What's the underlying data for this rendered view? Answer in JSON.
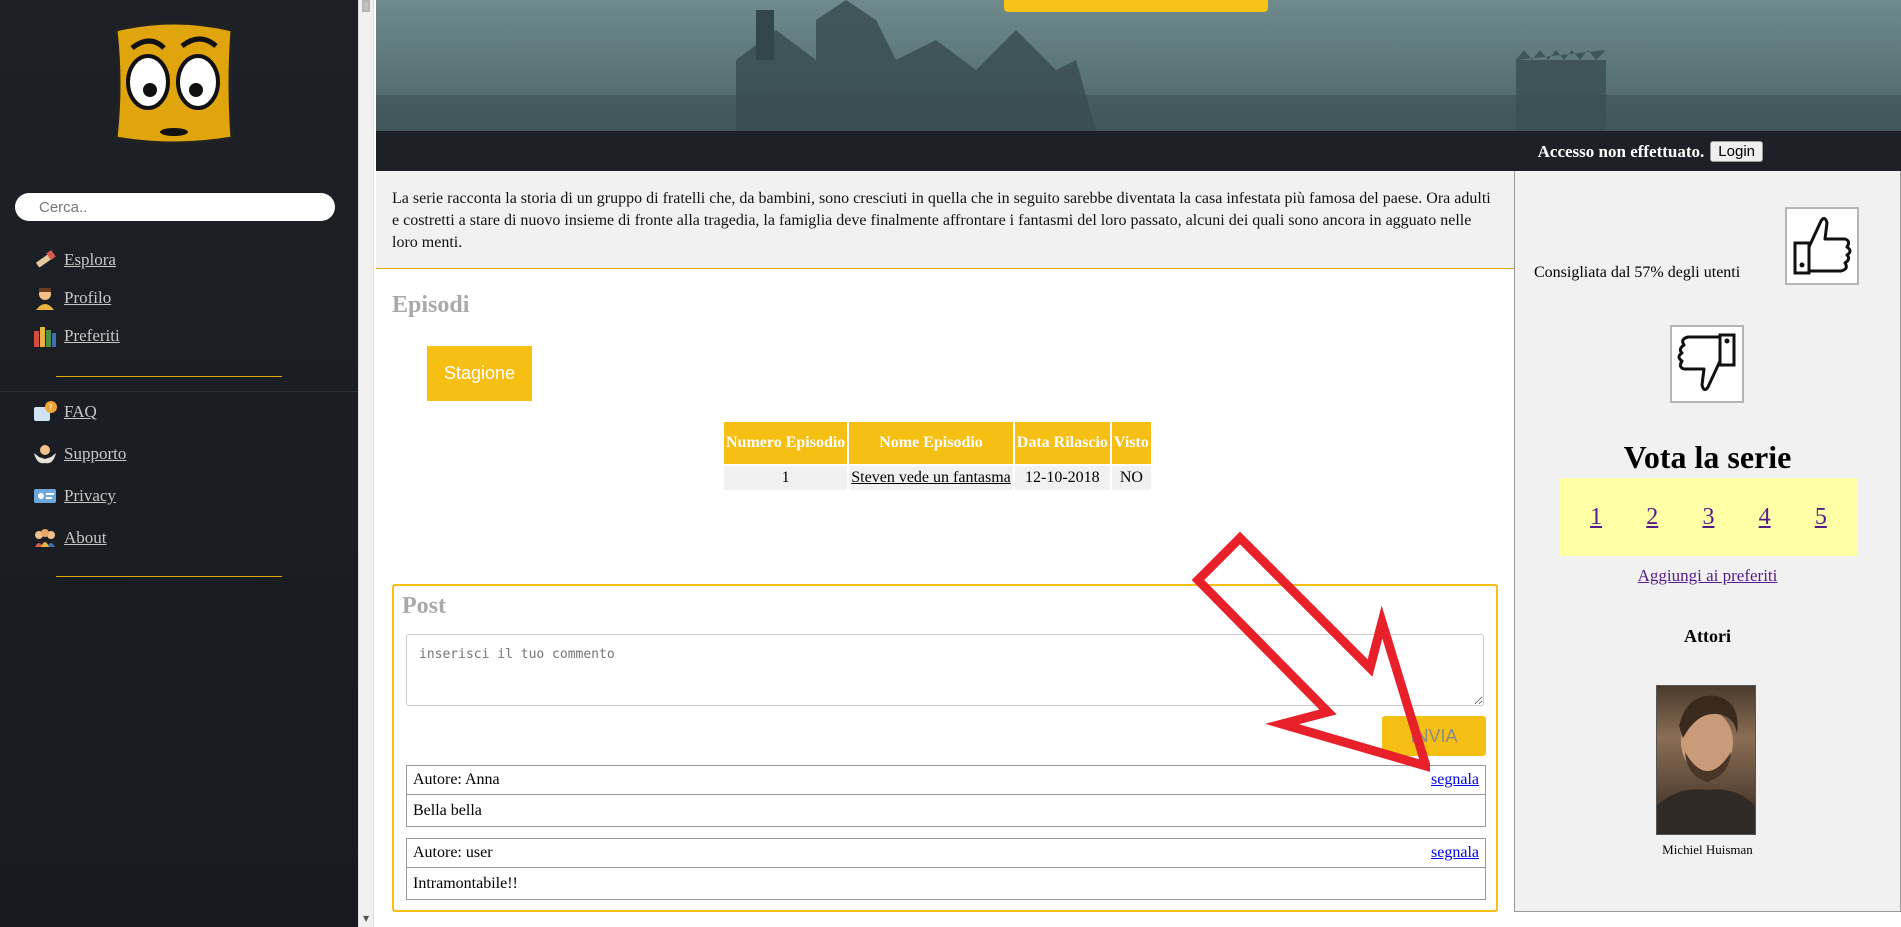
{
  "sidebar": {
    "search_placeholder": "Cerca..",
    "nav_main": [
      {
        "label": "Esplora",
        "icon": "flashlight-icon"
      },
      {
        "label": "Profilo",
        "icon": "user-icon"
      },
      {
        "label": "Preferiti",
        "icon": "books-icon"
      }
    ],
    "nav_info": [
      {
        "label": "FAQ",
        "icon": "faq-icon"
      },
      {
        "label": "Supporto",
        "icon": "support-icon"
      },
      {
        "label": "Privacy",
        "icon": "privacy-icon"
      },
      {
        "label": "About",
        "icon": "team-icon"
      }
    ]
  },
  "topbar": {
    "status": "Accesso non effettuato.",
    "login_label": "Login"
  },
  "description": "La serie racconta la storia di un gruppo di fratelli che, da bambini, sono cresciuti in quella che in seguito sarebbe diventata la casa infestata più famosa del paese. Ora adulti e costretti a stare di nuovo insieme di fronte alla tragedia, la famiglia deve finalmente affrontare i fantasmi del loro passato, alcuni dei quali sono ancora in agguato nelle loro menti.",
  "episodes": {
    "title": "Episodi",
    "season_button": "Stagione",
    "columns": [
      "Numero Episodio",
      "Nome Episodio",
      "Data Rilascio",
      "Visto"
    ],
    "rows": [
      {
        "numero": "1",
        "nome": "Steven vede un fantasma",
        "data": "12-10-2018",
        "visto": "NO"
      }
    ]
  },
  "post": {
    "title": "Post",
    "placeholder": "inserisci il tuo commento",
    "send_label": "INVIA",
    "comments": [
      {
        "author": "Autore: Anna",
        "report": "segnala",
        "text": "Bella bella"
      },
      {
        "author": "Autore: user",
        "report": "segnala",
        "text": "Intramontabile!!"
      }
    ]
  },
  "right_panel": {
    "recommended": "Consigliata dal 57% degli utenti",
    "vote_title": "Vota la serie",
    "ratings": [
      "1",
      "2",
      "3",
      "4",
      "5"
    ],
    "favorites_link": "Aggiungi ai preferiti",
    "actors_title": "Attori",
    "actors": [
      {
        "name": "Michiel Huisman"
      }
    ]
  },
  "colors": {
    "accent": "#f6bf14",
    "sidebar_bg": "#1d2127",
    "annotation_arrow": "#e8202a"
  }
}
